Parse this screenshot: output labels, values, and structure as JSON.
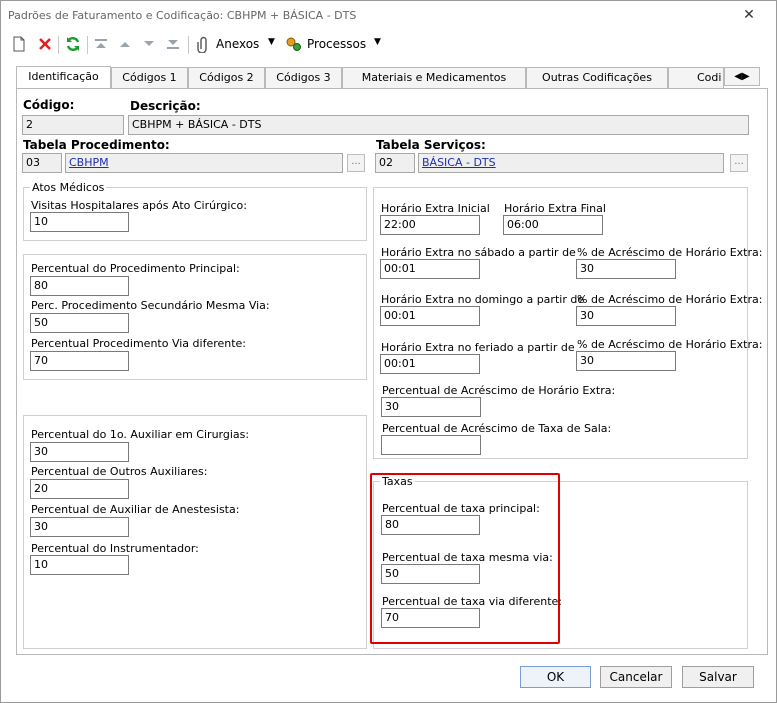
{
  "window": {
    "title": "Padrões de Faturamento e Codificação: CBHPM + BÁSICA - DTS",
    "close": "✕"
  },
  "toolbar": {
    "attachments_label": "Anexos",
    "processes_label": "Processos"
  },
  "tabs": [
    {
      "label": "Identificação",
      "active": true
    },
    {
      "label": "Códigos 1"
    },
    {
      "label": "Códigos 2"
    },
    {
      "label": "Códigos 3"
    },
    {
      "label": "Materiais e Medicamentos"
    },
    {
      "label": "Outras Codificações"
    },
    {
      "label": "Codi"
    }
  ],
  "form": {
    "codigo_label": "Código:",
    "codigo_value": "2",
    "descricao_label": "Descrição:",
    "descricao_value": "CBHPM + BÁSICA - DTS",
    "tabela_proc_label": "Tabela Procedimento:",
    "tabela_proc_code": "03",
    "tabela_proc_name": "CBHPM",
    "tabela_serv_label": "Tabela Serviços:",
    "tabela_serv_code": "02",
    "tabela_serv_name": "BÁSICA - DTS",
    "ellipsis": "..."
  },
  "atos": {
    "title": "Atos Médicos",
    "visitas_label": "Visitas Hospitalares após Ato Cirúrgico:",
    "visitas_value": "10"
  },
  "percentuais": {
    "principal_label": "Percentual do Procedimento Principal:",
    "principal_value": "80",
    "secundario_label": "Perc. Procedimento Secundário Mesma Via:",
    "secundario_value": "50",
    "via_dif_label": "Percentual Procedimento Via diferente:",
    "via_dif_value": "70"
  },
  "auxiliares": {
    "aux1_label": "Percentual do 1o. Auxiliar em Cirurgias:",
    "aux1_value": "30",
    "outros_label": "Percentual de Outros Auxiliares:",
    "outros_value": "20",
    "anest_label": "Percentual de Auxiliar de Anestesista:",
    "anest_value": "30",
    "instr_label": "Percentual do Instrumentador:",
    "instr_value": "10"
  },
  "horario": {
    "inicial_label": "Horário Extra Inicial",
    "inicial_value": "22:00",
    "final_label": "Horário Extra Final",
    "final_value": "06:00",
    "sabado_label": "Horário Extra no sábado a partir de",
    "sabado_value": "00:01",
    "sabado_pct_label": "% de Acréscimo de Horário Extra:",
    "sabado_pct_value": "30",
    "domingo_label": "Horário Extra no domingo a partir de",
    "domingo_value": "00:01",
    "domingo_pct_label": "% de Acréscimo de Horário Extra:",
    "domingo_pct_value": "30",
    "feriado_label": "Horário Extra no feriado a partir de",
    "feriado_value": "00:01",
    "feriado_pct_label": "% de Acréscimo de Horário Extra:",
    "feriado_pct_value": "30",
    "acrescimo_label": "Percentual de Acréscimo de Horário Extra:",
    "acrescimo_value": "30",
    "taxa_sala_label": "Percentual de Acréscimo de Taxa de Sala:",
    "taxa_sala_value": ""
  },
  "taxas": {
    "title": "Taxas",
    "principal_label": "Percentual de taxa principal:",
    "principal_value": "80",
    "mesma_via_label": "Percentual de taxa mesma via:",
    "mesma_via_value": "50",
    "via_dif_label": "Percentual de taxa via diferente:",
    "via_dif_value": "70"
  },
  "buttons": {
    "ok": "OK",
    "cancel": "Cancelar",
    "save": "Salvar"
  },
  "colors": {
    "highlight": "#e00000",
    "link": "#1a2fb3",
    "delete_icon": "#e02020",
    "refresh_icon": "#1f9a2c"
  }
}
